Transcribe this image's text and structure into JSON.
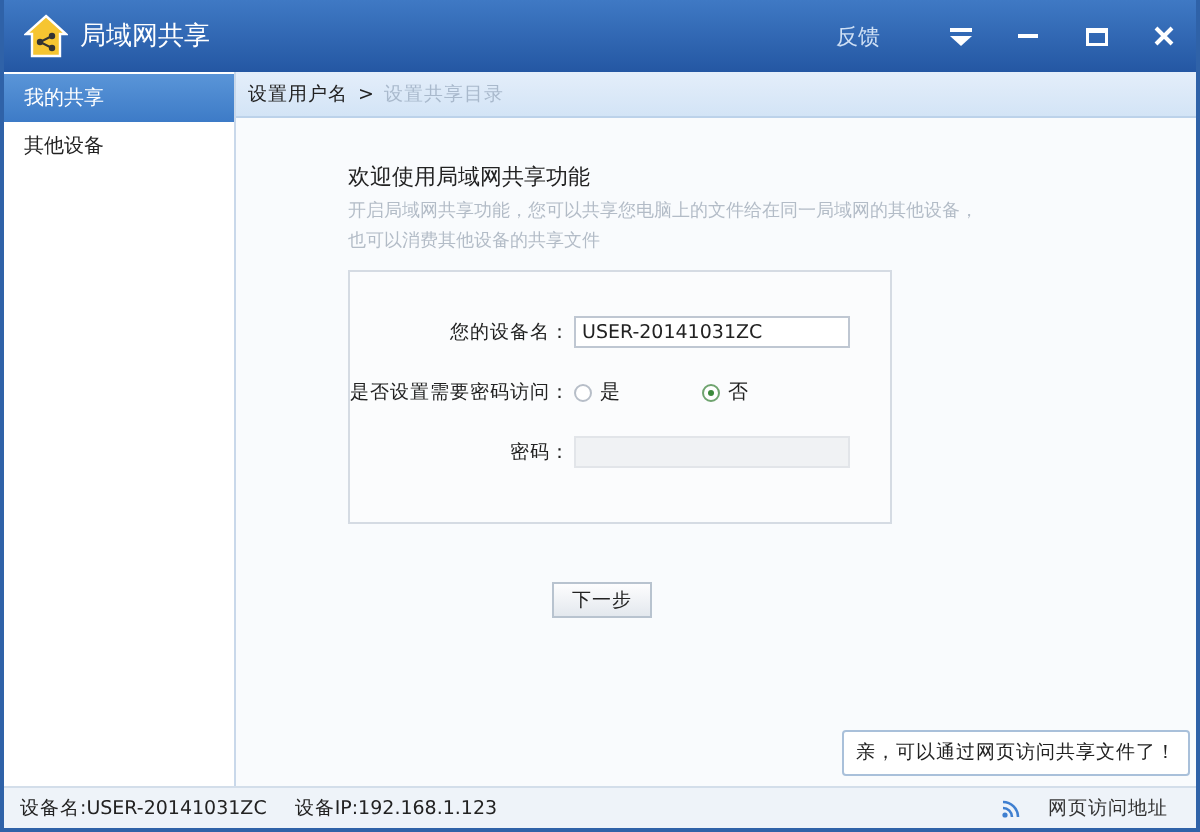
{
  "window": {
    "title": "局域网共享",
    "feedback": "反馈"
  },
  "sidebar": {
    "items": [
      {
        "label": "我的共享",
        "selected": true
      },
      {
        "label": "其他设备",
        "selected": false
      }
    ]
  },
  "breadcrumb": [
    {
      "label": "设置用户名",
      "current": true
    },
    {
      "label": ">",
      "current": true
    },
    {
      "label": "设置共享目录",
      "current": false
    }
  ],
  "intro": {
    "title": "欢迎使用局域网共享功能",
    "lines": [
      "开启局域网共享功能，您可以共享您电脑上的文件给在同一局域网的其他设备，",
      "也可以消费其他设备的共享文件"
    ]
  },
  "form": [
    {
      "kind": "text",
      "label": "您的设备名：",
      "value": "USER-20141031ZC"
    },
    {
      "kind": "radio",
      "label": "是否设置需要密码访问：",
      "options": [
        {
          "label": "是",
          "selected": false
        },
        {
          "label": "否",
          "selected": true
        }
      ]
    },
    {
      "kind": "password",
      "label": "密码：",
      "disabled": true
    }
  ],
  "next_button": "下一步",
  "tooltip": "亲，可以通过网页访问共享文件了！",
  "status_bar": {
    "device_name": "设备名:USER-20141031ZC",
    "device_ip": "设备IP:192.168.1.123",
    "web_link": "网页访问地址"
  }
}
